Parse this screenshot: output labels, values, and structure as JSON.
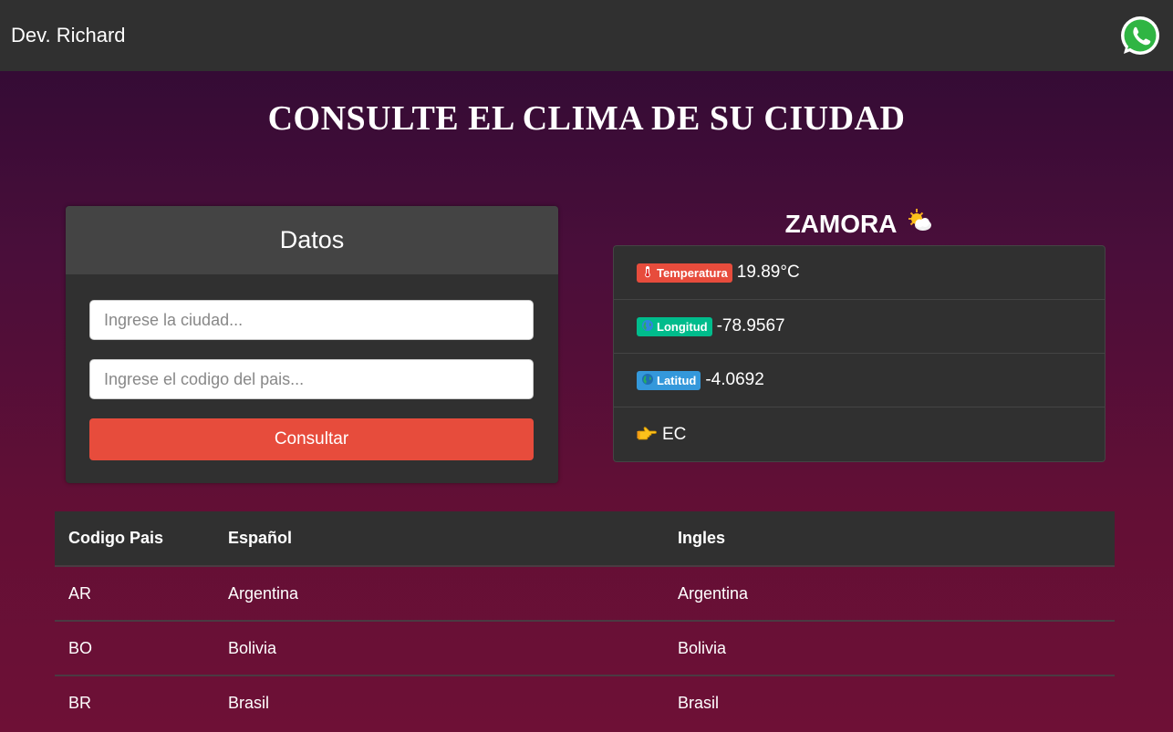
{
  "navbar": {
    "brand": "Dev. Richard",
    "whatsapp_icon": "whatsapp-icon"
  },
  "page": {
    "title": "CONSULTE EL CLIMA DE SU CIUDAD"
  },
  "form": {
    "header": "Datos",
    "city_placeholder": "Ingrese la ciudad...",
    "city_value": "",
    "country_placeholder": "Ingrese el codigo del pais...",
    "country_value": "",
    "submit_label": "Consultar",
    "submit_color": "#e74c3c"
  },
  "result": {
    "city": "ZAMORA",
    "weather_icon": "sun-behind-cloud-icon",
    "items": [
      {
        "badge": "Temperatura",
        "badge_icon": "thermometer-icon",
        "badge_color": "#e74c3c",
        "value": "19.89°C"
      },
      {
        "badge": "Longitud",
        "badge_icon": "globe-icon",
        "badge_color": "#00bc8c",
        "value": "-78.9567"
      },
      {
        "badge": "Latitud",
        "badge_icon": "globe-icon",
        "badge_color": "#3498db",
        "value": "-4.0692"
      },
      {
        "badge": "",
        "badge_icon": "pointing-hand-icon",
        "value": "EC"
      }
    ]
  },
  "countries_table": {
    "headers": [
      "Codigo Pais",
      "Español",
      "Ingles"
    ],
    "rows": [
      [
        "AR",
        "Argentina",
        "Argentina"
      ],
      [
        "BO",
        "Bolivia",
        "Bolivia"
      ],
      [
        "BR",
        "Brasil",
        "Brasil"
      ]
    ]
  }
}
